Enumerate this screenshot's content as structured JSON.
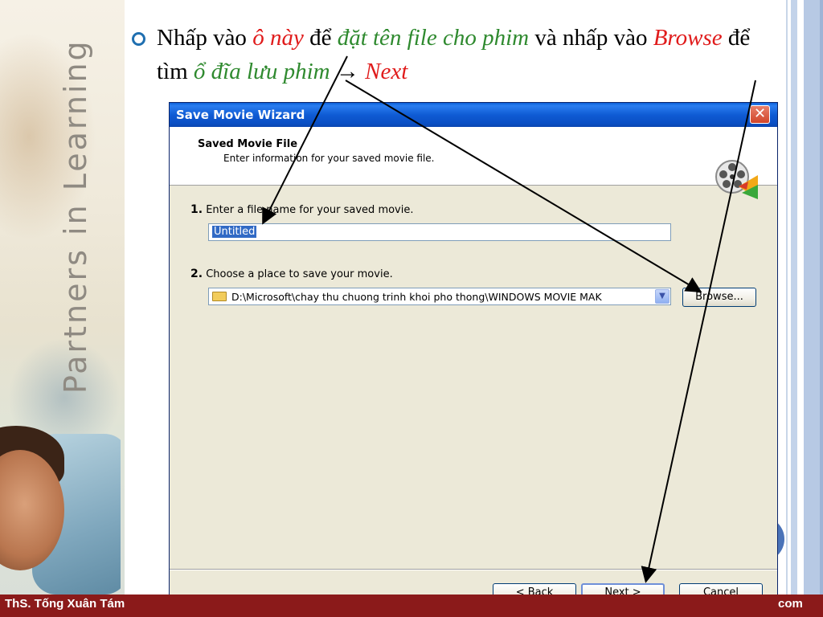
{
  "slide": {
    "bullet_text": {
      "p1": "Nhấp vào ",
      "p2": "ô này",
      "p3": " để ",
      "p4": "đặt tên file cho phim",
      "p5": " và nhấp vào ",
      "p6": "Browse",
      "p7": " để tìm ",
      "p8": "ổ đĩa lưu phim",
      "p9": " → ",
      "p10": "Next"
    },
    "side_text": "Partners in Learning",
    "footer_left": "ThS. Tống Xuân Tám",
    "footer_right": "com",
    "colors": {
      "footer": "#8b1a1a",
      "red_text": "#e01b1b",
      "green_text": "#2f8a2f",
      "arrow": "#000000"
    }
  },
  "dialog": {
    "title": "Save Movie Wizard",
    "close_label": "✕",
    "header_title": "Saved Movie File",
    "header_subtitle": "Enter information for your saved movie file.",
    "header_icon": "movie-reel-icon",
    "step1": {
      "number": "1.",
      "label": "Enter a file name for your saved movie.",
      "value": "Untitled"
    },
    "step2": {
      "number": "2.",
      "label": "Choose a place to save your movie.",
      "path": "D:\\Microsoft\\chay thu chuong trinh khoi pho thong\\WINDOWS MOVIE MAK",
      "browse_label": "Browse..."
    },
    "buttons": {
      "back": "< Back",
      "next": "Next >",
      "cancel": "Cancel"
    }
  }
}
